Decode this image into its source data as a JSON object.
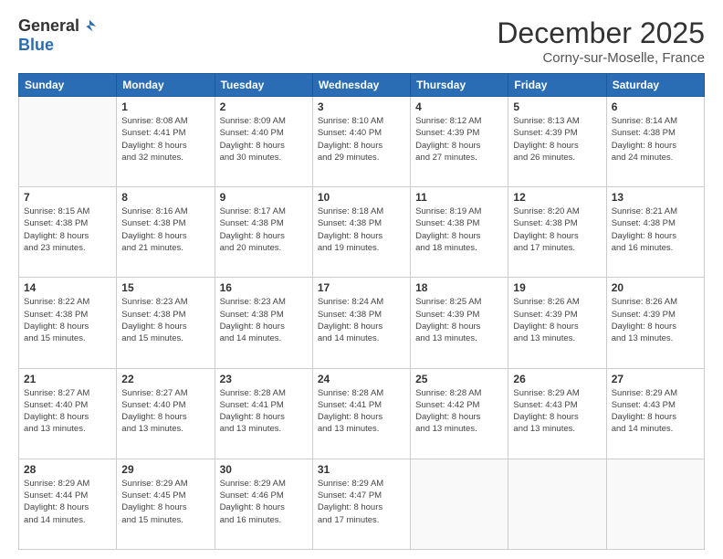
{
  "logo": {
    "general": "General",
    "blue": "Blue"
  },
  "header": {
    "month": "December 2025",
    "location": "Corny-sur-Moselle, France"
  },
  "days_of_week": [
    "Sunday",
    "Monday",
    "Tuesday",
    "Wednesday",
    "Thursday",
    "Friday",
    "Saturday"
  ],
  "weeks": [
    [
      {
        "day": "",
        "info": ""
      },
      {
        "day": "1",
        "info": "Sunrise: 8:08 AM\nSunset: 4:41 PM\nDaylight: 8 hours\nand 32 minutes."
      },
      {
        "day": "2",
        "info": "Sunrise: 8:09 AM\nSunset: 4:40 PM\nDaylight: 8 hours\nand 30 minutes."
      },
      {
        "day": "3",
        "info": "Sunrise: 8:10 AM\nSunset: 4:40 PM\nDaylight: 8 hours\nand 29 minutes."
      },
      {
        "day": "4",
        "info": "Sunrise: 8:12 AM\nSunset: 4:39 PM\nDaylight: 8 hours\nand 27 minutes."
      },
      {
        "day": "5",
        "info": "Sunrise: 8:13 AM\nSunset: 4:39 PM\nDaylight: 8 hours\nand 26 minutes."
      },
      {
        "day": "6",
        "info": "Sunrise: 8:14 AM\nSunset: 4:38 PM\nDaylight: 8 hours\nand 24 minutes."
      }
    ],
    [
      {
        "day": "7",
        "info": "Sunrise: 8:15 AM\nSunset: 4:38 PM\nDaylight: 8 hours\nand 23 minutes."
      },
      {
        "day": "8",
        "info": "Sunrise: 8:16 AM\nSunset: 4:38 PM\nDaylight: 8 hours\nand 21 minutes."
      },
      {
        "day": "9",
        "info": "Sunrise: 8:17 AM\nSunset: 4:38 PM\nDaylight: 8 hours\nand 20 minutes."
      },
      {
        "day": "10",
        "info": "Sunrise: 8:18 AM\nSunset: 4:38 PM\nDaylight: 8 hours\nand 19 minutes."
      },
      {
        "day": "11",
        "info": "Sunrise: 8:19 AM\nSunset: 4:38 PM\nDaylight: 8 hours\nand 18 minutes."
      },
      {
        "day": "12",
        "info": "Sunrise: 8:20 AM\nSunset: 4:38 PM\nDaylight: 8 hours\nand 17 minutes."
      },
      {
        "day": "13",
        "info": "Sunrise: 8:21 AM\nSunset: 4:38 PM\nDaylight: 8 hours\nand 16 minutes."
      }
    ],
    [
      {
        "day": "14",
        "info": "Sunrise: 8:22 AM\nSunset: 4:38 PM\nDaylight: 8 hours\nand 15 minutes."
      },
      {
        "day": "15",
        "info": "Sunrise: 8:23 AM\nSunset: 4:38 PM\nDaylight: 8 hours\nand 15 minutes."
      },
      {
        "day": "16",
        "info": "Sunrise: 8:23 AM\nSunset: 4:38 PM\nDaylight: 8 hours\nand 14 minutes."
      },
      {
        "day": "17",
        "info": "Sunrise: 8:24 AM\nSunset: 4:38 PM\nDaylight: 8 hours\nand 14 minutes."
      },
      {
        "day": "18",
        "info": "Sunrise: 8:25 AM\nSunset: 4:39 PM\nDaylight: 8 hours\nand 13 minutes."
      },
      {
        "day": "19",
        "info": "Sunrise: 8:26 AM\nSunset: 4:39 PM\nDaylight: 8 hours\nand 13 minutes."
      },
      {
        "day": "20",
        "info": "Sunrise: 8:26 AM\nSunset: 4:39 PM\nDaylight: 8 hours\nand 13 minutes."
      }
    ],
    [
      {
        "day": "21",
        "info": "Sunrise: 8:27 AM\nSunset: 4:40 PM\nDaylight: 8 hours\nand 13 minutes."
      },
      {
        "day": "22",
        "info": "Sunrise: 8:27 AM\nSunset: 4:40 PM\nDaylight: 8 hours\nand 13 minutes."
      },
      {
        "day": "23",
        "info": "Sunrise: 8:28 AM\nSunset: 4:41 PM\nDaylight: 8 hours\nand 13 minutes."
      },
      {
        "day": "24",
        "info": "Sunrise: 8:28 AM\nSunset: 4:41 PM\nDaylight: 8 hours\nand 13 minutes."
      },
      {
        "day": "25",
        "info": "Sunrise: 8:28 AM\nSunset: 4:42 PM\nDaylight: 8 hours\nand 13 minutes."
      },
      {
        "day": "26",
        "info": "Sunrise: 8:29 AM\nSunset: 4:43 PM\nDaylight: 8 hours\nand 13 minutes."
      },
      {
        "day": "27",
        "info": "Sunrise: 8:29 AM\nSunset: 4:43 PM\nDaylight: 8 hours\nand 14 minutes."
      }
    ],
    [
      {
        "day": "28",
        "info": "Sunrise: 8:29 AM\nSunset: 4:44 PM\nDaylight: 8 hours\nand 14 minutes."
      },
      {
        "day": "29",
        "info": "Sunrise: 8:29 AM\nSunset: 4:45 PM\nDaylight: 8 hours\nand 15 minutes."
      },
      {
        "day": "30",
        "info": "Sunrise: 8:29 AM\nSunset: 4:46 PM\nDaylight: 8 hours\nand 16 minutes."
      },
      {
        "day": "31",
        "info": "Sunrise: 8:29 AM\nSunset: 4:47 PM\nDaylight: 8 hours\nand 17 minutes."
      },
      {
        "day": "",
        "info": ""
      },
      {
        "day": "",
        "info": ""
      },
      {
        "day": "",
        "info": ""
      }
    ]
  ]
}
